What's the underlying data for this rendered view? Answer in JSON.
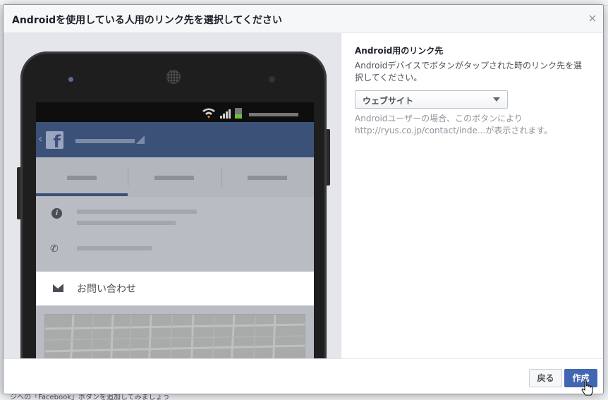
{
  "modal": {
    "title": "Androidを使用している人用のリンク先を選択してください",
    "close_glyph": "×"
  },
  "settings": {
    "label": "Android用のリンク先",
    "description": "Androidデバイスでボタンがタップされた時のリンク先を選択してください。",
    "select_value": "ウェブサイト",
    "note": "Androidユーザーの場合、このボタンにより http://ryus.co.jp/contact/inde...が表示されます。"
  },
  "preview": {
    "contact_label": "お問い合わせ",
    "fb_logo": "f"
  },
  "footer": {
    "back_label": "戻る",
    "create_label": "作成"
  },
  "background": {
    "bottom_text": "ジへの「Facebook」ボタンを追加してみましょう"
  },
  "colors": {
    "primary_button": "#4267b2",
    "facebook_bar": "#3b5178"
  },
  "icons": [
    "close-icon",
    "dropdown-arrow-icon",
    "wifi-icon",
    "signal-icon",
    "battery-icon",
    "facebook-logo-icon",
    "info-icon",
    "phone-icon",
    "mail-icon",
    "pointer-cursor-icon"
  ]
}
